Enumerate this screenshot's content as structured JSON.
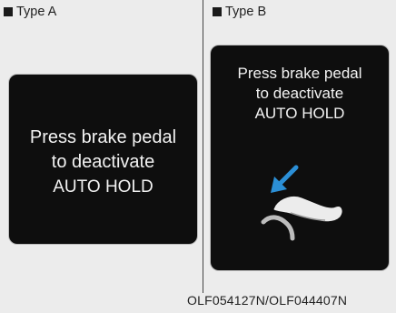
{
  "panel_a": {
    "label": "Type A",
    "line1": "Press brake pedal",
    "line2": "to deactivate",
    "line3": "AUTO HOLD"
  },
  "panel_b": {
    "label": "Type B",
    "line1": "Press brake pedal",
    "line2": "to deactivate",
    "line3": "AUTO HOLD",
    "icon": "brake-pedal-press-icon"
  },
  "caption": "OLF054127N/OLF044407N",
  "colors": {
    "background": "#ececec",
    "screen": "#0e0e0e",
    "screen_text": "#f2f2f2",
    "arrow": "#2b8fd6"
  }
}
